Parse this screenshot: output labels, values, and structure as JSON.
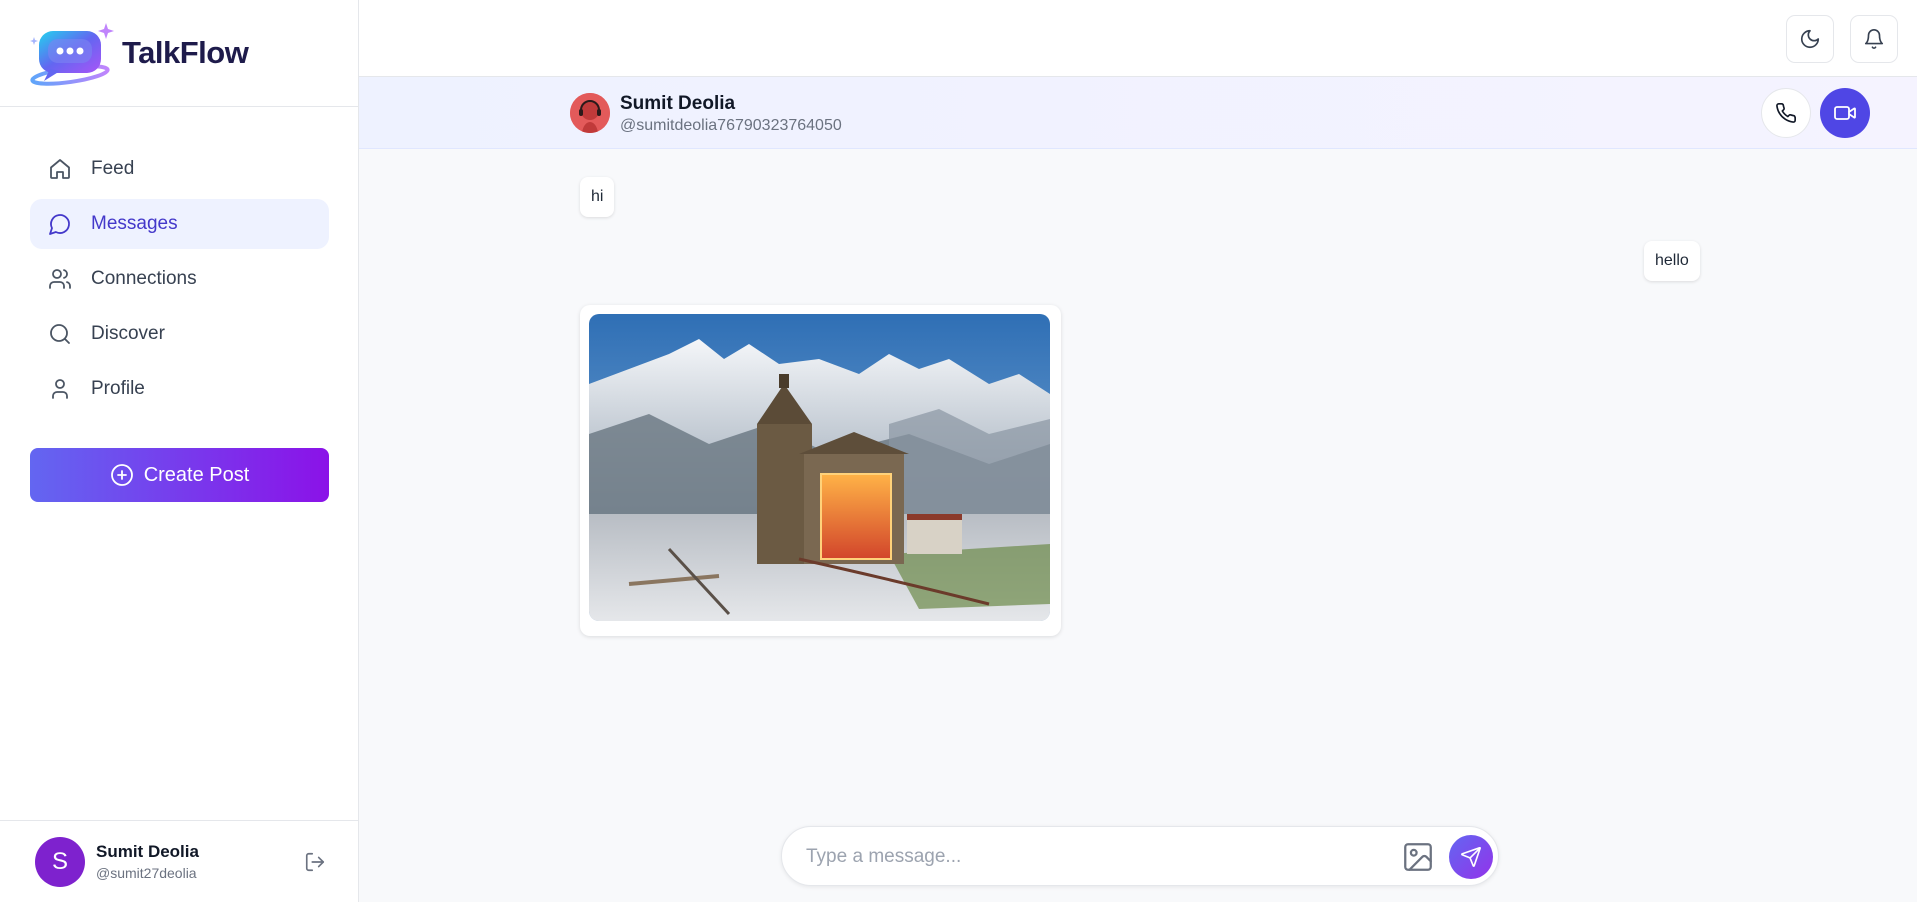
{
  "brand": {
    "name": "TalkFlow"
  },
  "sidebar": {
    "items": [
      {
        "label": "Feed",
        "icon": "home-icon"
      },
      {
        "label": "Messages",
        "icon": "message-circle-icon",
        "active": true
      },
      {
        "label": "Connections",
        "icon": "users-icon"
      },
      {
        "label": "Discover",
        "icon": "search-icon"
      },
      {
        "label": "Profile",
        "icon": "user-icon"
      }
    ],
    "create_post_label": "Create Post"
  },
  "current_user": {
    "initial": "S",
    "name": "Sumit Deolia",
    "handle": "@sumit27deolia"
  },
  "chat": {
    "contact_name": "Sumit Deolia",
    "contact_handle": "@sumitdeolia76790323764050",
    "messages": [
      {
        "side": "left",
        "type": "text",
        "text": "hi"
      },
      {
        "side": "right",
        "type": "text",
        "text": "hello"
      },
      {
        "side": "left",
        "type": "image",
        "icon": "mountain-temple-photo"
      }
    ],
    "composer_placeholder": "Type a message..."
  },
  "colors": {
    "accent": "#4f46e5",
    "gradient_start": "#6366f1",
    "gradient_end": "#8b12e8",
    "active_bg": "#eef2ff"
  }
}
